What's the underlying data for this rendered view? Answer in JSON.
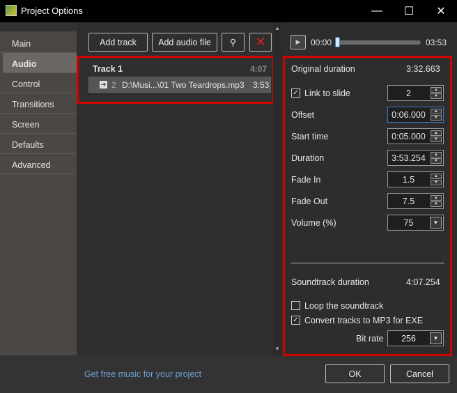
{
  "window": {
    "title": "Project Options",
    "minimize": "—",
    "maximize": "☐",
    "close": "✕"
  },
  "sidebar": {
    "items": [
      {
        "label": "Main"
      },
      {
        "label": "Audio",
        "selected": true
      },
      {
        "label": "Control"
      },
      {
        "label": "Transitions"
      },
      {
        "label": "Screen"
      },
      {
        "label": "Defaults"
      },
      {
        "label": "Advanced"
      }
    ]
  },
  "toolbar": {
    "add_track": "Add track",
    "add_audio_file": "Add audio file",
    "wand_icon": "magic-wand-icon",
    "delete_icon": "delete-x-icon"
  },
  "tracks": [
    {
      "name": "Track 1",
      "duration": "4:07",
      "files": [
        {
          "index": "2",
          "path": "D:\\Musi...\\01 Two Teardrops.mp3",
          "duration": "3:53"
        }
      ]
    }
  ],
  "player": {
    "current": "00:00",
    "total": "03:53",
    "progress": 0
  },
  "props": {
    "original_duration_label": "Original duration",
    "original_duration": "3:32.663",
    "link_to_slide_label": "Link to slide",
    "link_to_slide_checked": true,
    "link_to_slide": "2",
    "offset_label": "Offset",
    "offset": "0:06.000",
    "start_time_label": "Start time",
    "start_time": "0:05.000",
    "duration_label": "Duration",
    "duration": "3:53.254",
    "fade_in_label": "Fade In",
    "fade_in": "1.5",
    "fade_out_label": "Fade Out",
    "fade_out": "7.5",
    "volume_label": "Volume (%)",
    "volume": "75",
    "soundtrack_duration_label": "Soundtrack duration",
    "soundtrack_duration": "4:07.254",
    "loop_label": "Loop the soundtrack",
    "loop_checked": false,
    "convert_label": "Convert tracks to MP3 for EXE",
    "convert_checked": true,
    "bitrate_label": "Bit rate",
    "bitrate": "256"
  },
  "footer": {
    "link": "Get free music for your project",
    "ok": "OK",
    "cancel": "Cancel"
  },
  "colors": {
    "highlight": "#d40000",
    "link": "#6e9fd0",
    "focus": "#3d7fc4"
  }
}
